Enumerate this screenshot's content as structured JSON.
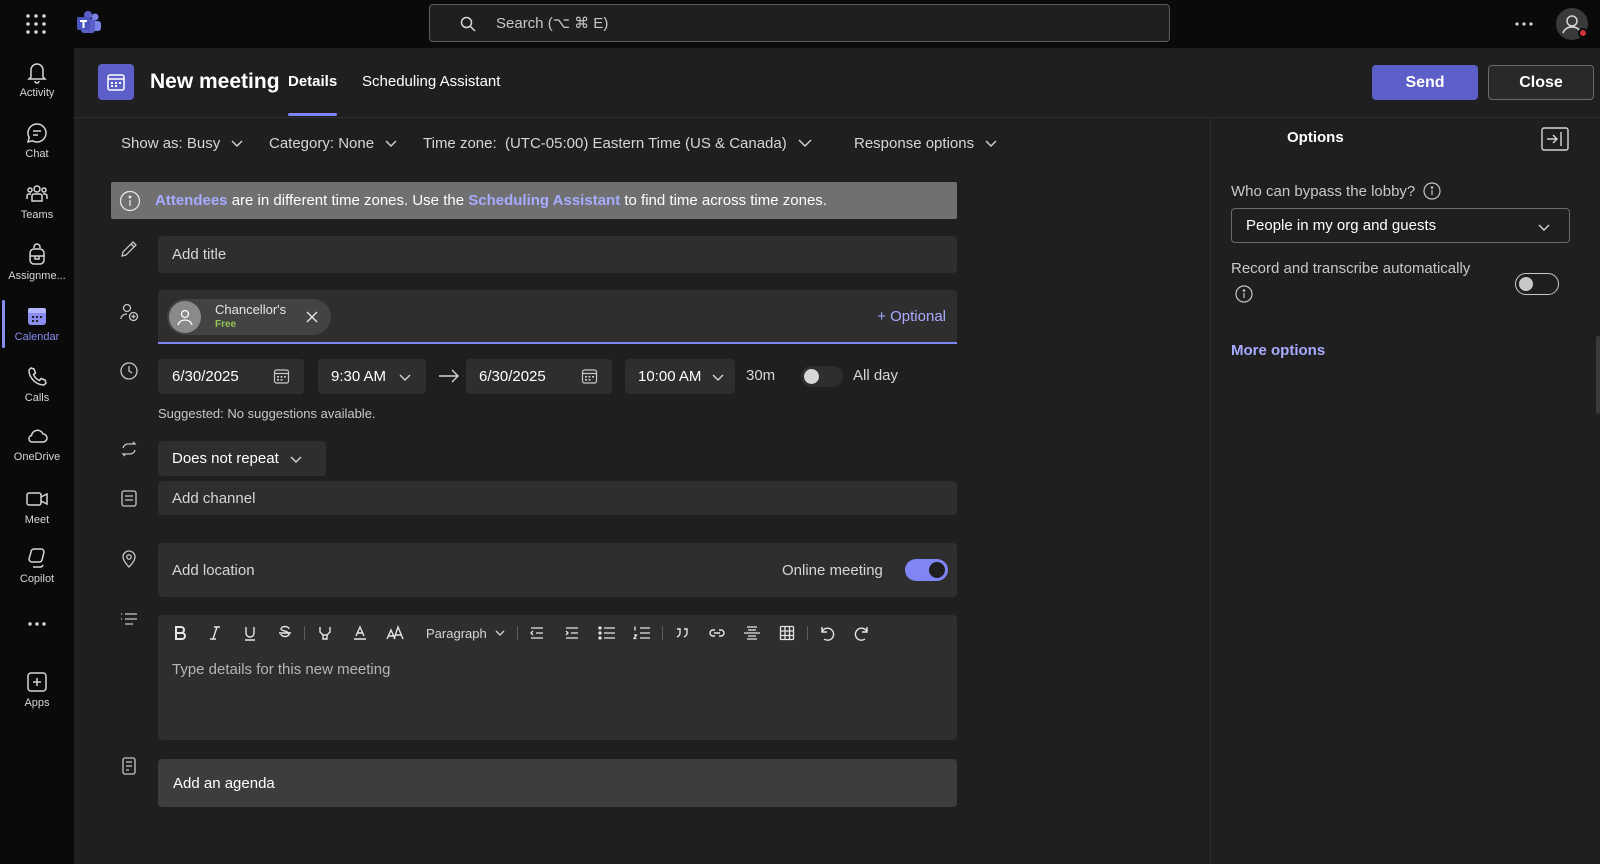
{
  "topbar": {
    "search_placeholder": "Search (⌥ ⌘ E)",
    "icons": [
      "app-launcher-icon",
      "teams-logo",
      "search-icon",
      "more-icon",
      "profile-icon"
    ],
    "presence_color": "#d13438"
  },
  "rail": {
    "items": [
      {
        "label": "Activity",
        "icon": "bell-icon"
      },
      {
        "label": "Chat",
        "icon": "chat-icon"
      },
      {
        "label": "Teams",
        "icon": "teams-icon"
      },
      {
        "label": "Assignme...",
        "icon": "backpack-icon"
      },
      {
        "label": "Calendar",
        "icon": "calendar-icon",
        "active": true
      },
      {
        "label": "Calls",
        "icon": "phone-icon"
      },
      {
        "label": "OneDrive",
        "icon": "cloud-icon"
      },
      {
        "label": "Meet",
        "icon": "video-icon"
      },
      {
        "label": "Copilot",
        "icon": "copilot-icon"
      },
      {
        "label": "",
        "icon": "more-apps-icon"
      },
      {
        "label": "Apps",
        "icon": "add-app-icon"
      }
    ],
    "accent": "#8b8cf0"
  },
  "header": {
    "title": "New meeting",
    "tabs": [
      {
        "label": "Details",
        "active": true
      },
      {
        "label": "Scheduling Assistant"
      }
    ],
    "send_label": "Send",
    "close_label": "Close",
    "brand_color": "#5b5fc7"
  },
  "options_bar": {
    "show_as": "Show as: Busy",
    "category": "Category: None",
    "time_zone": "Time zone:  (UTC-05:00) Eastern Time (US & Canada)",
    "response": "Response options"
  },
  "banner": {
    "link1": "Attendees",
    "text1": " are in different time zones. Use the ",
    "link2": "Scheduling Assistant",
    "text2": " to find time across time zones."
  },
  "form": {
    "title_placeholder": "Add title",
    "attendee": {
      "name": "Chancellor's",
      "status": "Free"
    },
    "optional_label": "+ Optional",
    "start_date": "6/30/2025",
    "start_time": "9:30 AM",
    "end_date": "6/30/2025",
    "end_time": "10:00 AM",
    "duration": "30m",
    "all_day_label": "All day",
    "suggestion": "Suggested: No suggestions available.",
    "repeat": "Does not repeat",
    "channel_placeholder": "Add channel",
    "location_placeholder": "Add location",
    "online_meeting_label": "Online meeting",
    "online_meeting_on": true,
    "all_day_on": false,
    "paragraph_label": "Paragraph",
    "details_placeholder": "Type details for this new meeting",
    "agenda_label": "Add an agenda"
  },
  "options_panel": {
    "title": "Options",
    "lobby_label": "Who can bypass the lobby?",
    "lobby_value": "People in my org and guests",
    "record_label": "Record and transcribe automatically",
    "record_on": false,
    "more_options": "More options"
  }
}
